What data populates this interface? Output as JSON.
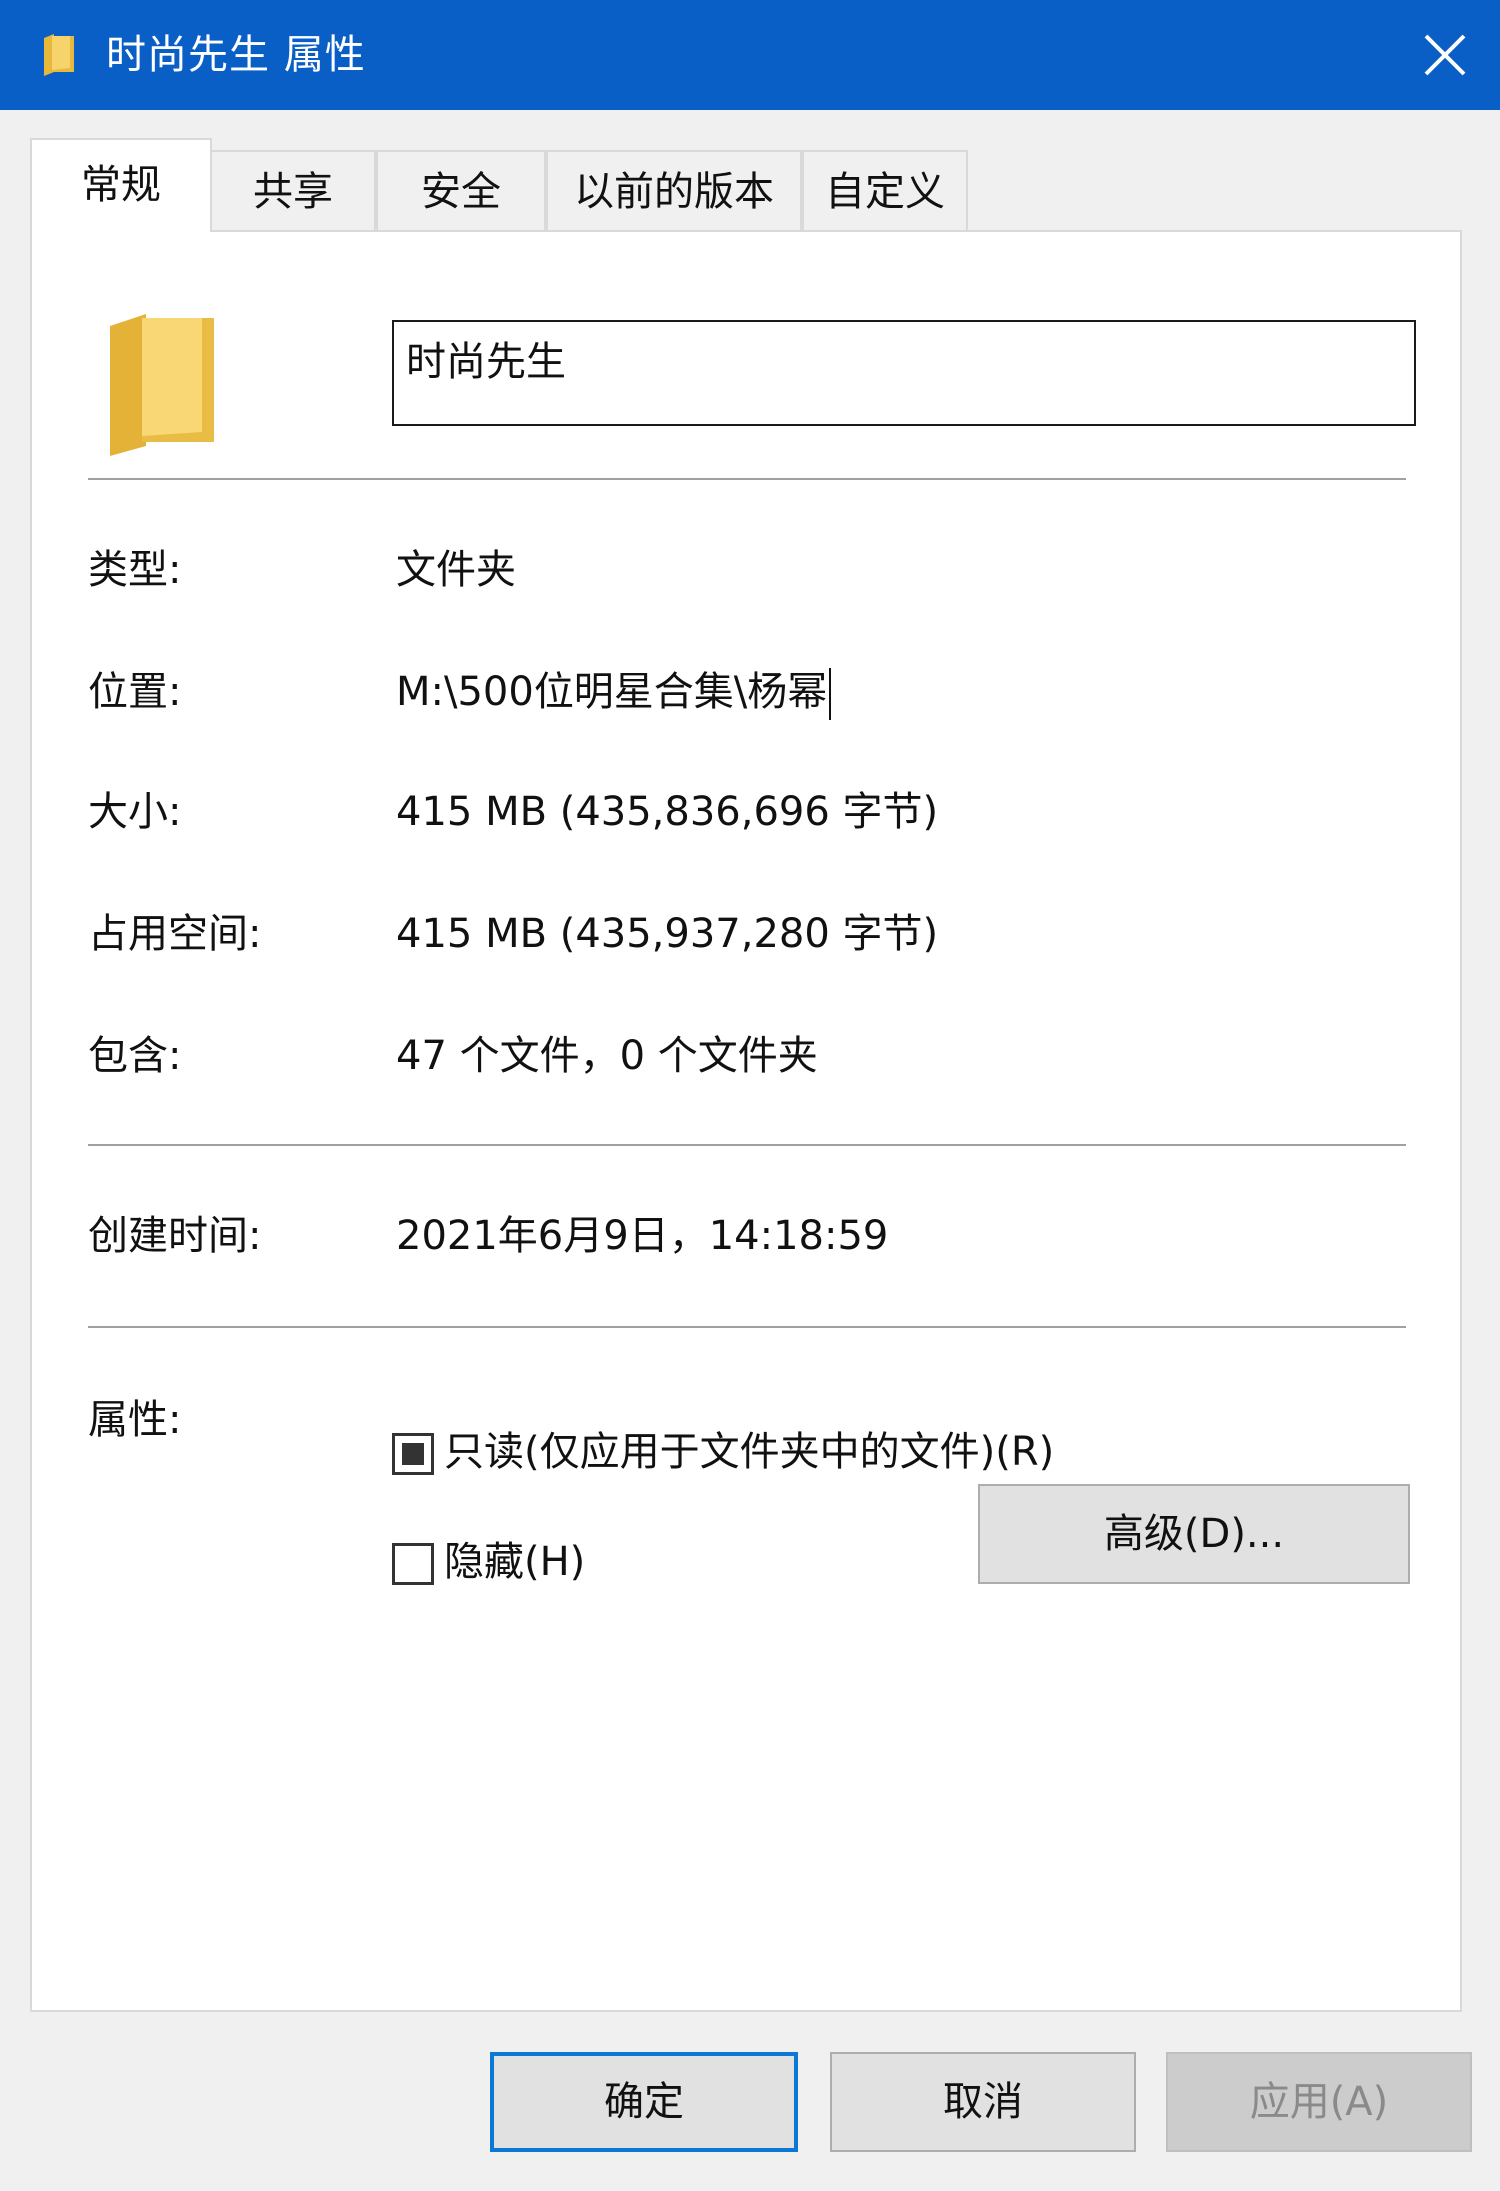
{
  "window": {
    "title": "时尚先生 属性",
    "close_icon": "close-icon",
    "accent_color": "#0a5fc7"
  },
  "tabs": [
    {
      "label": "常规",
      "active": true
    },
    {
      "label": "共享",
      "active": false
    },
    {
      "label": "安全",
      "active": false
    },
    {
      "label": "以前的版本",
      "active": false
    },
    {
      "label": "自定义",
      "active": false
    }
  ],
  "general": {
    "folder_name": "时尚先生",
    "type_label": "类型:",
    "type_value": "文件夹",
    "location_label": "位置:",
    "location_value": "M:\\500位明星合集\\杨幂",
    "size_label": "大小:",
    "size_value": "415 MB (435,836,696 字节)",
    "disk_size_label": "占用空间:",
    "disk_size_value": "415 MB (435,937,280 字节)",
    "contains_label": "包含:",
    "contains_value": "47 个文件，0 个文件夹",
    "created_label": "创建时间:",
    "created_value": "2021年6月9日，14:18:59",
    "attributes_label": "属性:",
    "readonly_label": "只读(仅应用于文件夹中的文件)(R)",
    "readonly_state": "indeterminate",
    "hidden_label": "隐藏(H)",
    "hidden_state": "unchecked",
    "advanced_button": "高级(D)..."
  },
  "footer": {
    "ok": "确定",
    "cancel": "取消",
    "apply": "应用(A)"
  }
}
